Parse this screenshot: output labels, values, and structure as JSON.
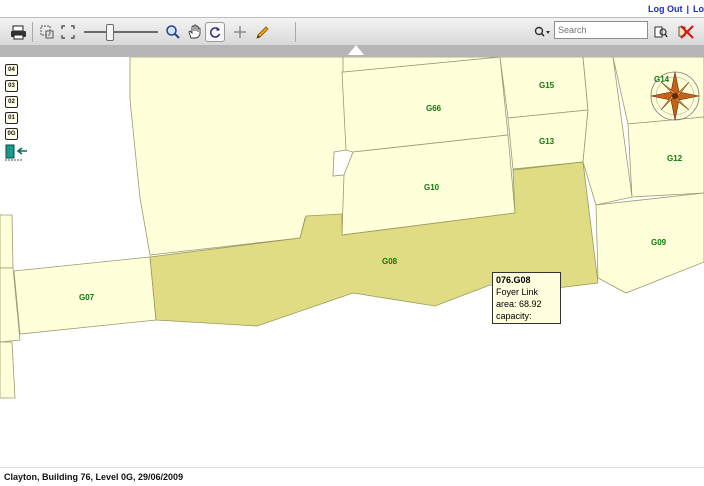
{
  "header": {
    "logout_label": "Log Out",
    "separator": "|",
    "extra_link": "Lo"
  },
  "toolbar": {
    "search_placeholder": "Search",
    "icons": [
      "print-icon",
      "select-region-icon",
      "full-extent-icon",
      "zoom-slider",
      "magnifier-icon",
      "pan-hand-icon",
      "refresh-icon",
      "add-icon",
      "pencil-icon",
      "search-dropdown-icon",
      "query-icon",
      "clear-selection-icon"
    ]
  },
  "levels": [
    "04",
    "03",
    "02",
    "01",
    "0G"
  ],
  "rooms": {
    "g66": "G66",
    "g15": "G15",
    "g13": "G13",
    "g10": "G10",
    "g14": "G14",
    "g12": "G12",
    "g09": "G09",
    "g08": "G08",
    "g07": "G07"
  },
  "colors": {
    "room_fill": "#ffffd9",
    "selected_fill": "#e0dc83",
    "room_stroke": "#8a8a6a",
    "label": "#0d7a0d"
  },
  "tooltip": {
    "id": "076.G08",
    "name": "Foyer Link",
    "area": "area: 68.92",
    "capacity": "capacity:"
  },
  "footer": {
    "status": "Clayton, Building 76, Level 0G, 29/06/2009"
  }
}
